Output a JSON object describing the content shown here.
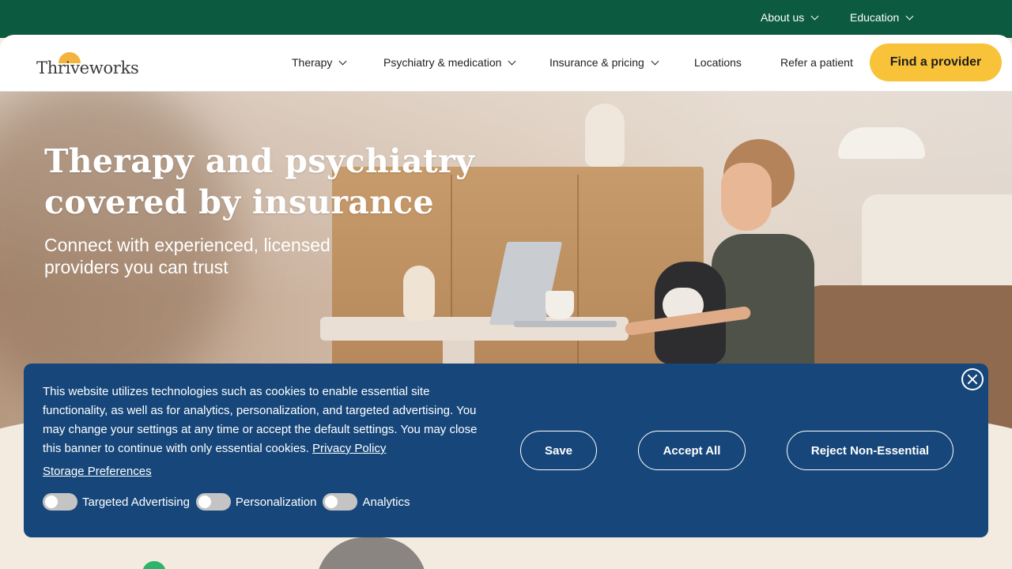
{
  "topbar": {
    "items": [
      {
        "label": "About us"
      },
      {
        "label": "Education"
      }
    ]
  },
  "nav": {
    "logo_text": "Thriveworks",
    "items": [
      {
        "label": "Therapy"
      },
      {
        "label": "Psychiatry & medication"
      },
      {
        "label": "Insurance & pricing"
      },
      {
        "label": "Locations"
      },
      {
        "label": "Refer a patient"
      }
    ],
    "cta_label": "Find a provider"
  },
  "hero": {
    "title_line1": "Therapy and psychiatry",
    "title_line2": "covered by insurance",
    "subtitle": "Connect with experienced, licensed providers you can trust"
  },
  "cookie_banner": {
    "text": "This website utilizes technologies such as cookies to enable essential site functionality, as well as for analytics, personalization, and targeted advertising. You may change your settings at any time or accept the default settings. You may close this banner to continue with only essential cookies.",
    "privacy_link": "Privacy Policy",
    "storage_prefs": "Storage Preferences",
    "toggles": [
      {
        "label": "Targeted Advertising",
        "on": false
      },
      {
        "label": "Personalization",
        "on": false
      },
      {
        "label": "Analytics",
        "on": false
      }
    ],
    "save_label": "Save",
    "accept_label": "Accept All",
    "reject_label": "Reject Non-Essential"
  },
  "colors": {
    "topbar": "#0c5a3f",
    "cta": "#f9c339",
    "banner": "#17477a"
  }
}
